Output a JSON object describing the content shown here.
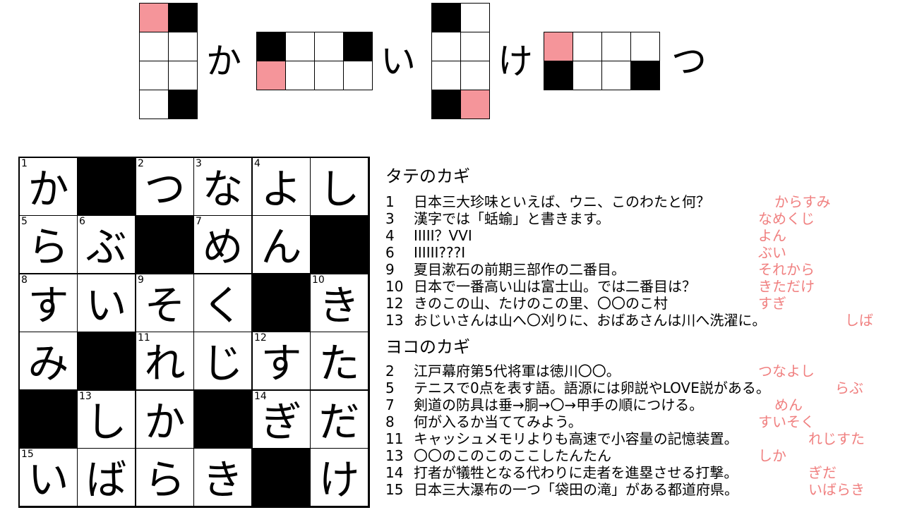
{
  "title_puzzle": {
    "separators": [
      "か",
      "い",
      "け",
      "つ"
    ]
  },
  "grid": {
    "rows": [
      [
        {
          "n": "1",
          "c": "か"
        },
        {
          "black": true
        },
        {
          "n": "2",
          "c": "つ"
        },
        {
          "n": "3",
          "c": "な"
        },
        {
          "n": "4",
          "c": "よ"
        },
        {
          "c": "し"
        }
      ],
      [
        {
          "n": "5",
          "c": "ら"
        },
        {
          "n": "6",
          "c": "ぶ"
        },
        {
          "black": true
        },
        {
          "n": "7",
          "c": "め"
        },
        {
          "c": "ん"
        },
        {
          "black": true
        }
      ],
      [
        {
          "n": "8",
          "c": "す"
        },
        {
          "c": "い"
        },
        {
          "n": "9",
          "c": "そ"
        },
        {
          "c": "く"
        },
        {
          "black": true
        },
        {
          "n": "10",
          "c": "き"
        }
      ],
      [
        {
          "c": "み"
        },
        {
          "black": true
        },
        {
          "n": "11",
          "c": "れ"
        },
        {
          "c": "じ"
        },
        {
          "n": "12",
          "c": "す"
        },
        {
          "c": "た"
        }
      ],
      [
        {
          "black": true
        },
        {
          "n": "13",
          "c": "し"
        },
        {
          "c": "か"
        },
        {
          "black": true
        },
        {
          "n": "14",
          "c": "ぎ"
        },
        {
          "c": "だ"
        }
      ],
      [
        {
          "n": "15",
          "c": "い"
        },
        {
          "c": "ば"
        },
        {
          "c": "ら"
        },
        {
          "c": "き"
        },
        {
          "black": true
        },
        {
          "c": "け"
        }
      ]
    ]
  },
  "clues": {
    "down_heading": "タテのカギ",
    "across_heading": "ヨコのカギ",
    "down": [
      {
        "num": "1",
        "text": "日本三大珍味といえば、ウニ、このわたと何？",
        "answer": "からすみ"
      },
      {
        "num": "3",
        "text": "漢字では「蛞蝓」と書きます。",
        "answer": "なめくじ"
      },
      {
        "num": "4",
        "text": "ⅠⅠⅠⅠⅠ？ⅤⅤⅠ",
        "answer": "よん"
      },
      {
        "num": "6",
        "text": "ⅠⅠⅠⅠⅠⅠ???Ⅰ",
        "answer": "ぶい"
      },
      {
        "num": "9",
        "text": "夏目漱石の前期三部作の二番目。",
        "answer": "それから"
      },
      {
        "num": "10",
        "text": "日本で一番高い山は富士山。では二番目は？",
        "answer": "きただけ"
      },
      {
        "num": "12",
        "text": "きのこの山、たけのこの里、〇〇のこ村",
        "answer": "すぎ"
      },
      {
        "num": "13",
        "text": "おじいさんは山へ〇刈りに、おばあさんは川へ洗濯に。",
        "answer": "しば"
      }
    ],
    "across": [
      {
        "num": "2",
        "text": "江戸幕府第5代将軍は徳川〇〇。",
        "answer": "つなよし"
      },
      {
        "num": "5",
        "text": "テニスで0点を表す語。語源には卵説やLOVE説がある。",
        "answer": "らぶ"
      },
      {
        "num": "7",
        "text": "剣道の防具は垂→胴→〇→甲手の順につける。",
        "answer": "めん"
      },
      {
        "num": "8",
        "text": "何が入るか当ててみよう。",
        "answer": "すいそく"
      },
      {
        "num": "11",
        "text": "キャッシュメモリよりも高速で小容量の記憶装置。",
        "answer": "れじすた"
      },
      {
        "num": "13",
        "text": "〇〇のこのこのここしたんたん",
        "answer": "しか"
      },
      {
        "num": "14",
        "text": "打者が犠牲となる代わりに走者を進塁させる打撃。",
        "answer": "ぎだ"
      },
      {
        "num": "15",
        "text": "日本三大瀑布の一つ「袋田の滝」がある都道府県。",
        "answer": "いばらき"
      }
    ]
  },
  "colors": {
    "highlight": "#f5959a",
    "answer_text": "#f08080"
  }
}
